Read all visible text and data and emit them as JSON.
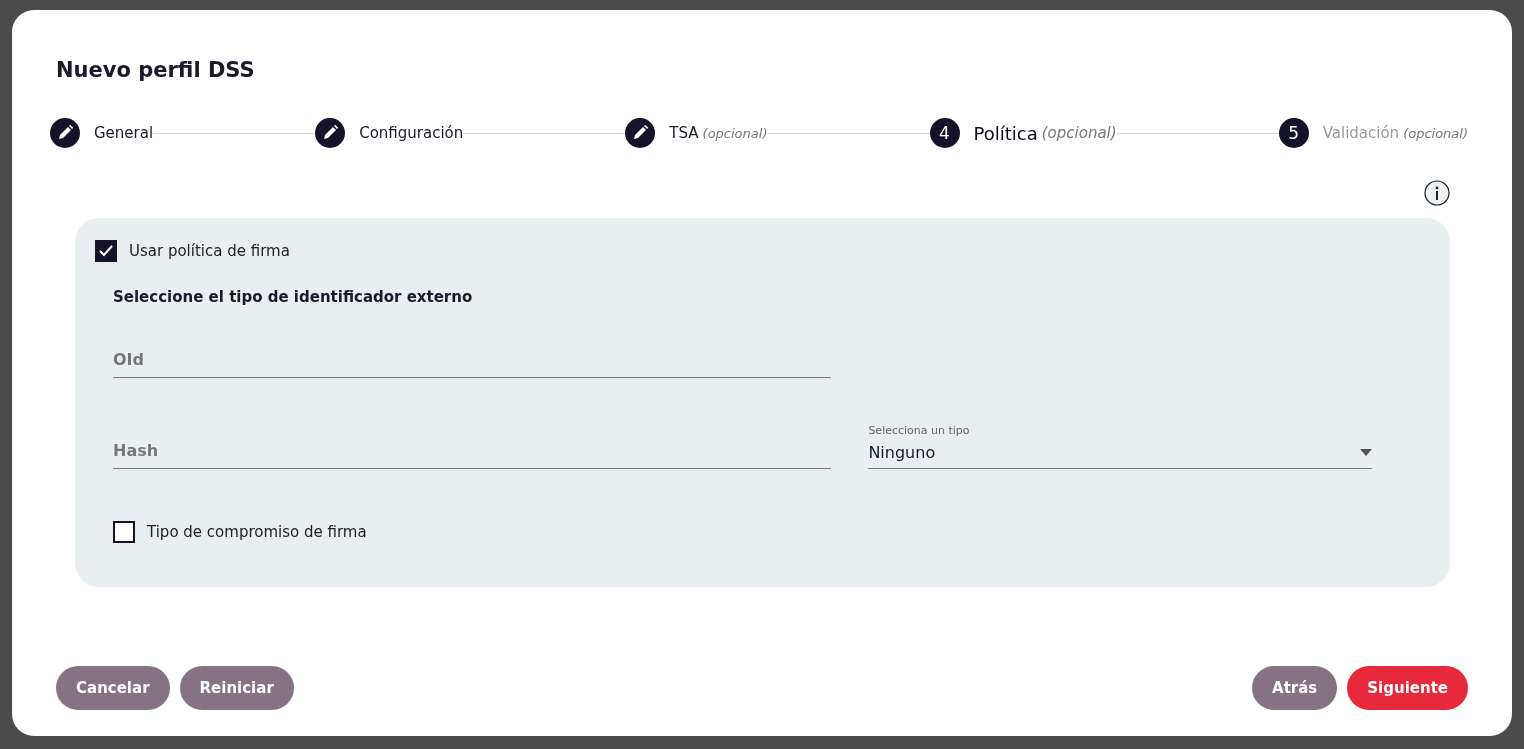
{
  "dialog": {
    "title": "Nuevo perfil DSS"
  },
  "steps": [
    {
      "kind": "edited",
      "label": "General",
      "selected": false,
      "disabled": false
    },
    {
      "kind": "edited",
      "label": "Configuración",
      "selected": false,
      "disabled": false
    },
    {
      "kind": "edited",
      "label": "TSA",
      "note": "(opcional)",
      "selected": false,
      "disabled": false
    },
    {
      "kind": "numbered",
      "number": "4",
      "label": "Política",
      "note": "(opcional)",
      "selected": true,
      "disabled": false
    },
    {
      "kind": "numbered",
      "number": "5",
      "label": "Validación",
      "note": "(opcional)",
      "selected": false,
      "disabled": true
    }
  ],
  "policy": {
    "use_policy": {
      "label": "Usar política de firma",
      "checked": true
    },
    "heading": "Seleccione el tipo de identificador externo",
    "oid": {
      "placeholder": "OId"
    },
    "hash": {
      "placeholder": "Hash"
    },
    "hash_type": {
      "label": "Selecciona un tipo",
      "value": "Ninguno"
    },
    "commitment": {
      "label": "Tipo de compromiso de firma",
      "checked": false
    }
  },
  "buttons_left": [
    {
      "label": "Cancelar",
      "kind": "secondary"
    },
    {
      "label": "Reiniciar",
      "kind": "secondary"
    }
  ],
  "buttons_right": [
    {
      "label": "Atrás",
      "kind": "secondary"
    },
    {
      "label": "Siguiente",
      "kind": "primary"
    }
  ]
}
